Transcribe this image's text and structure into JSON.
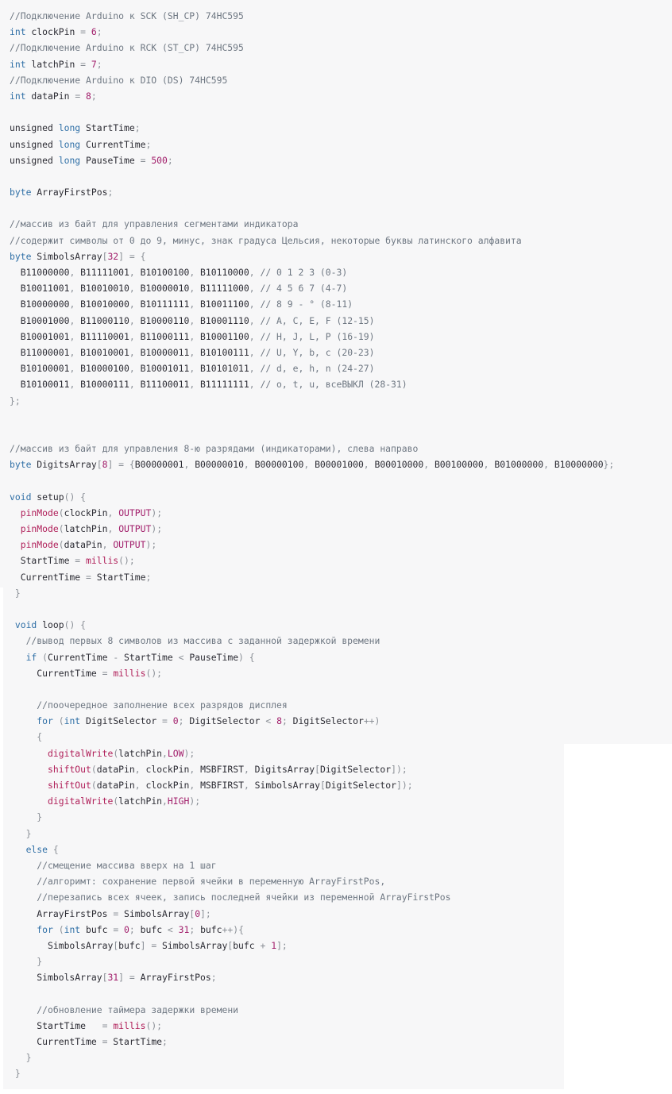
{
  "colors": {
    "background": "#f7f7f8",
    "comment": "#6e7782",
    "keyword": "#2f6fa6",
    "number": "#a11d6a",
    "function": "#b0205a",
    "text": "#2b2b33"
  },
  "code_lines": [
    [
      [
        "c",
        "//Подключение Arduino к SCK (SH_CP) 74HC595"
      ]
    ],
    [
      [
        "k",
        "int"
      ],
      [
        "v",
        " clockPin "
      ],
      [
        "p",
        "="
      ],
      [
        "v",
        " "
      ],
      [
        "n",
        "6"
      ],
      [
        "p",
        ";"
      ]
    ],
    [
      [
        "c",
        "//Подключение Arduino к RCK (ST_CP) 74HC595"
      ]
    ],
    [
      [
        "k",
        "int"
      ],
      [
        "v",
        " latchPin "
      ],
      [
        "p",
        "="
      ],
      [
        "v",
        " "
      ],
      [
        "n",
        "7"
      ],
      [
        "p",
        ";"
      ]
    ],
    [
      [
        "c",
        "//Подключение Arduino к DIO (DS) 74HC595"
      ]
    ],
    [
      [
        "k",
        "int"
      ],
      [
        "v",
        " dataPin "
      ],
      [
        "p",
        "="
      ],
      [
        "v",
        " "
      ],
      [
        "n",
        "8"
      ],
      [
        "p",
        ";"
      ]
    ],
    [],
    [
      [
        "v",
        "unsigned "
      ],
      [
        "k",
        "long"
      ],
      [
        "v",
        " StartTime"
      ],
      [
        "p",
        ";"
      ]
    ],
    [
      [
        "v",
        "unsigned "
      ],
      [
        "k",
        "long"
      ],
      [
        "v",
        " CurrentTime"
      ],
      [
        "p",
        ";"
      ]
    ],
    [
      [
        "v",
        "unsigned "
      ],
      [
        "k",
        "long"
      ],
      [
        "v",
        " PauseTime "
      ],
      [
        "p",
        "="
      ],
      [
        "v",
        " "
      ],
      [
        "n",
        "500"
      ],
      [
        "p",
        ";"
      ]
    ],
    [],
    [
      [
        "k",
        "byte"
      ],
      [
        "v",
        " ArrayFirstPos"
      ],
      [
        "p",
        ";"
      ]
    ],
    [],
    [
      [
        "c",
        "//массив из байт для управления сегментами индикатора"
      ]
    ],
    [
      [
        "c",
        "//содержит символы от 0 до 9, минус, знак градуса Цельсия, некоторые буквы латинского алфавита"
      ]
    ],
    [
      [
        "k",
        "byte"
      ],
      [
        "v",
        " SimbolsArray"
      ],
      [
        "p",
        "["
      ],
      [
        "n",
        "32"
      ],
      [
        "p",
        "]"
      ],
      [
        "v",
        " "
      ],
      [
        "p",
        "="
      ],
      [
        "v",
        " "
      ],
      [
        "p",
        "{"
      ]
    ],
    [
      [
        "v",
        "  B11000000"
      ],
      [
        "p",
        ","
      ],
      [
        "v",
        " B11111001"
      ],
      [
        "p",
        ","
      ],
      [
        "v",
        " B10100100"
      ],
      [
        "p",
        ","
      ],
      [
        "v",
        " B10110000"
      ],
      [
        "p",
        ","
      ],
      [
        "v",
        " "
      ],
      [
        "c",
        "// 0 1 2 3 (0-3)"
      ]
    ],
    [
      [
        "v",
        "  B10011001"
      ],
      [
        "p",
        ","
      ],
      [
        "v",
        " B10010010"
      ],
      [
        "p",
        ","
      ],
      [
        "v",
        " B10000010"
      ],
      [
        "p",
        ","
      ],
      [
        "v",
        " B11111000"
      ],
      [
        "p",
        ","
      ],
      [
        "v",
        " "
      ],
      [
        "c",
        "// 4 5 6 7 (4-7)"
      ]
    ],
    [
      [
        "v",
        "  B10000000"
      ],
      [
        "p",
        ","
      ],
      [
        "v",
        " B10010000"
      ],
      [
        "p",
        ","
      ],
      [
        "v",
        " B10111111"
      ],
      [
        "p",
        ","
      ],
      [
        "v",
        " B10011100"
      ],
      [
        "p",
        ","
      ],
      [
        "v",
        " "
      ],
      [
        "c",
        "// 8 9 - ° (8-11)"
      ]
    ],
    [
      [
        "v",
        "  B10001000"
      ],
      [
        "p",
        ","
      ],
      [
        "v",
        " B11000110"
      ],
      [
        "p",
        ","
      ],
      [
        "v",
        " B10000110"
      ],
      [
        "p",
        ","
      ],
      [
        "v",
        " B10001110"
      ],
      [
        "p",
        ","
      ],
      [
        "v",
        " "
      ],
      [
        "c",
        "// A, C, E, F (12-15)"
      ]
    ],
    [
      [
        "v",
        "  B10001001"
      ],
      [
        "p",
        ","
      ],
      [
        "v",
        " B11110001"
      ],
      [
        "p",
        ","
      ],
      [
        "v",
        " B11000111"
      ],
      [
        "p",
        ","
      ],
      [
        "v",
        " B10001100"
      ],
      [
        "p",
        ","
      ],
      [
        "v",
        " "
      ],
      [
        "c",
        "// H, J, L, P (16-19)"
      ]
    ],
    [
      [
        "v",
        "  B11000001"
      ],
      [
        "p",
        ","
      ],
      [
        "v",
        " B10010001"
      ],
      [
        "p",
        ","
      ],
      [
        "v",
        " B10000011"
      ],
      [
        "p",
        ","
      ],
      [
        "v",
        " B10100111"
      ],
      [
        "p",
        ","
      ],
      [
        "v",
        " "
      ],
      [
        "c",
        "// U, Y, b, c (20-23)"
      ]
    ],
    [
      [
        "v",
        "  B10100001"
      ],
      [
        "p",
        ","
      ],
      [
        "v",
        " B10000100"
      ],
      [
        "p",
        ","
      ],
      [
        "v",
        " B10001011"
      ],
      [
        "p",
        ","
      ],
      [
        "v",
        " B10101011"
      ],
      [
        "p",
        ","
      ],
      [
        "v",
        " "
      ],
      [
        "c",
        "// d, e, h, n (24-27)"
      ]
    ],
    [
      [
        "v",
        "  B10100011"
      ],
      [
        "p",
        ","
      ],
      [
        "v",
        " B10000111"
      ],
      [
        "p",
        ","
      ],
      [
        "v",
        " B11100011"
      ],
      [
        "p",
        ","
      ],
      [
        "v",
        " B11111111"
      ],
      [
        "p",
        ","
      ],
      [
        "v",
        " "
      ],
      [
        "c",
        "// o, t, u, всеВЫКЛ (28-31)"
      ]
    ],
    [
      [
        "p",
        "};"
      ]
    ],
    [],
    [],
    [
      [
        "c",
        "//массив из байт для управления 8-ю разрядами (индикаторами), слева направо"
      ]
    ],
    [
      [
        "k",
        "byte"
      ],
      [
        "v",
        " DigitsArray"
      ],
      [
        "p",
        "["
      ],
      [
        "n",
        "8"
      ],
      [
        "p",
        "]"
      ],
      [
        "v",
        " "
      ],
      [
        "p",
        "="
      ],
      [
        "v",
        " "
      ],
      [
        "p",
        "{"
      ],
      [
        "v",
        "B00000001"
      ],
      [
        "p",
        ","
      ],
      [
        "v",
        " B00000010"
      ],
      [
        "p",
        ","
      ],
      [
        "v",
        " B00000100"
      ],
      [
        "p",
        ","
      ],
      [
        "v",
        " B00001000"
      ],
      [
        "p",
        ","
      ],
      [
        "v",
        " B00010000"
      ],
      [
        "p",
        ","
      ],
      [
        "v",
        " B00100000"
      ],
      [
        "p",
        ","
      ],
      [
        "v",
        " B01000000"
      ],
      [
        "p",
        ","
      ],
      [
        "v",
        " B10000000"
      ],
      [
        "p",
        "};"
      ]
    ],
    [],
    [
      [
        "k",
        "void"
      ],
      [
        "v",
        " setup"
      ],
      [
        "p",
        "()"
      ],
      [
        "v",
        " "
      ],
      [
        "p",
        "{"
      ]
    ],
    [
      [
        "v",
        "  "
      ],
      [
        "f",
        "pinMode"
      ],
      [
        "p",
        "("
      ],
      [
        "v",
        "clockPin"
      ],
      [
        "p",
        ","
      ],
      [
        "v",
        " "
      ],
      [
        "n",
        "OUTPUT"
      ],
      [
        "p",
        ");"
      ]
    ],
    [
      [
        "v",
        "  "
      ],
      [
        "f",
        "pinMode"
      ],
      [
        "p",
        "("
      ],
      [
        "v",
        "latchPin"
      ],
      [
        "p",
        ","
      ],
      [
        "v",
        " "
      ],
      [
        "n",
        "OUTPUT"
      ],
      [
        "p",
        ");"
      ]
    ],
    [
      [
        "v",
        "  "
      ],
      [
        "f",
        "pinMode"
      ],
      [
        "p",
        "("
      ],
      [
        "v",
        "dataPin"
      ],
      [
        "p",
        ","
      ],
      [
        "v",
        " "
      ],
      [
        "n",
        "OUTPUT"
      ],
      [
        "p",
        ");"
      ]
    ],
    [
      [
        "v",
        "  StartTime "
      ],
      [
        "p",
        "="
      ],
      [
        "v",
        " "
      ],
      [
        "f",
        "millis"
      ],
      [
        "p",
        "();"
      ]
    ],
    [
      [
        "v",
        "  CurrentTime "
      ],
      [
        "p",
        "="
      ],
      [
        "v",
        " StartTime"
      ],
      [
        "p",
        ";"
      ]
    ],
    [
      [
        "p",
        " }"
      ]
    ],
    [],
    [
      [
        "v",
        " "
      ],
      [
        "k",
        "void"
      ],
      [
        "v",
        " loop"
      ],
      [
        "p",
        "()"
      ],
      [
        "v",
        " "
      ],
      [
        "p",
        "{"
      ]
    ],
    [
      [
        "v",
        "   "
      ],
      [
        "c",
        "//вывод первых 8 символов из массива с заданной задержкой времени"
      ]
    ],
    [
      [
        "v",
        "   "
      ],
      [
        "k",
        "if"
      ],
      [
        "v",
        " "
      ],
      [
        "p",
        "("
      ],
      [
        "v",
        "CurrentTime "
      ],
      [
        "p",
        "-"
      ],
      [
        "v",
        " StartTime "
      ],
      [
        "p",
        "<"
      ],
      [
        "v",
        " PauseTime"
      ],
      [
        "p",
        ")"
      ],
      [
        "v",
        " "
      ],
      [
        "p",
        "{"
      ]
    ],
    [
      [
        "v",
        "     CurrentTime "
      ],
      [
        "p",
        "="
      ],
      [
        "v",
        " "
      ],
      [
        "f",
        "millis"
      ],
      [
        "p",
        "();"
      ]
    ],
    [],
    [
      [
        "v",
        "     "
      ],
      [
        "c",
        "//поочередное заполнение всех разрядов дисплея"
      ]
    ],
    [
      [
        "v",
        "     "
      ],
      [
        "k",
        "for"
      ],
      [
        "v",
        " "
      ],
      [
        "p",
        "("
      ],
      [
        "k",
        "int"
      ],
      [
        "v",
        " DigitSelector "
      ],
      [
        "p",
        "="
      ],
      [
        "v",
        " "
      ],
      [
        "n",
        "0"
      ],
      [
        "p",
        ";"
      ],
      [
        "v",
        " DigitSelector "
      ],
      [
        "p",
        "<"
      ],
      [
        "v",
        " "
      ],
      [
        "n",
        "8"
      ],
      [
        "p",
        ";"
      ],
      [
        "v",
        " DigitSelector"
      ],
      [
        "p",
        "++)"
      ]
    ],
    [
      [
        "v",
        "     "
      ],
      [
        "p",
        "{"
      ]
    ],
    [
      [
        "v",
        "       "
      ],
      [
        "f",
        "digitalWrite"
      ],
      [
        "p",
        "("
      ],
      [
        "v",
        "latchPin"
      ],
      [
        "p",
        ","
      ],
      [
        "n",
        "LOW"
      ],
      [
        "p",
        ");"
      ]
    ],
    [
      [
        "v",
        "       "
      ],
      [
        "f",
        "shiftOut"
      ],
      [
        "p",
        "("
      ],
      [
        "v",
        "dataPin"
      ],
      [
        "p",
        ","
      ],
      [
        "v",
        " clockPin"
      ],
      [
        "p",
        ","
      ],
      [
        "v",
        " MSBFIRST"
      ],
      [
        "p",
        ","
      ],
      [
        "v",
        " DigitsArray"
      ],
      [
        "p",
        "["
      ],
      [
        "v",
        "DigitSelector"
      ],
      [
        "p",
        "]);"
      ]
    ],
    [
      [
        "v",
        "       "
      ],
      [
        "f",
        "shiftOut"
      ],
      [
        "p",
        "("
      ],
      [
        "v",
        "dataPin"
      ],
      [
        "p",
        ","
      ],
      [
        "v",
        " clockPin"
      ],
      [
        "p",
        ","
      ],
      [
        "v",
        " MSBFIRST"
      ],
      [
        "p",
        ","
      ],
      [
        "v",
        " SimbolsArray"
      ],
      [
        "p",
        "["
      ],
      [
        "v",
        "DigitSelector"
      ],
      [
        "p",
        "]);"
      ]
    ],
    [
      [
        "v",
        "       "
      ],
      [
        "f",
        "digitalWrite"
      ],
      [
        "p",
        "("
      ],
      [
        "v",
        "latchPin"
      ],
      [
        "p",
        ","
      ],
      [
        "n",
        "HIGH"
      ],
      [
        "p",
        ");"
      ]
    ],
    [
      [
        "v",
        "     "
      ],
      [
        "p",
        "}"
      ]
    ],
    [
      [
        "v",
        "   "
      ],
      [
        "p",
        "}"
      ]
    ],
    [
      [
        "v",
        "   "
      ],
      [
        "k",
        "else"
      ],
      [
        "v",
        " "
      ],
      [
        "p",
        "{"
      ]
    ],
    [
      [
        "v",
        "     "
      ],
      [
        "c",
        "//смещение массива вверх на 1 шаг"
      ]
    ],
    [
      [
        "v",
        "     "
      ],
      [
        "c",
        "//алгоримт: сохранение первой ячейки в переменную ArrayFirstPos,"
      ]
    ],
    [
      [
        "v",
        "     "
      ],
      [
        "c",
        "//перезапись всех ячеек, запись последней ячейки из переменной ArrayFirstPos"
      ]
    ],
    [
      [
        "v",
        "     ArrayFirstPos "
      ],
      [
        "p",
        "="
      ],
      [
        "v",
        " SimbolsArray"
      ],
      [
        "p",
        "["
      ],
      [
        "n",
        "0"
      ],
      [
        "p",
        "];"
      ]
    ],
    [
      [
        "v",
        "     "
      ],
      [
        "k",
        "for"
      ],
      [
        "v",
        " "
      ],
      [
        "p",
        "("
      ],
      [
        "k",
        "int"
      ],
      [
        "v",
        " bufc "
      ],
      [
        "p",
        "="
      ],
      [
        "v",
        " "
      ],
      [
        "n",
        "0"
      ],
      [
        "p",
        ";"
      ],
      [
        "v",
        " bufc "
      ],
      [
        "p",
        "<"
      ],
      [
        "v",
        " "
      ],
      [
        "n",
        "31"
      ],
      [
        "p",
        ";"
      ],
      [
        "v",
        " bufc"
      ],
      [
        "p",
        "++){"
      ]
    ],
    [
      [
        "v",
        "       SimbolsArray"
      ],
      [
        "p",
        "["
      ],
      [
        "v",
        "bufc"
      ],
      [
        "p",
        "]"
      ],
      [
        "v",
        " "
      ],
      [
        "p",
        "="
      ],
      [
        "v",
        " SimbolsArray"
      ],
      [
        "p",
        "["
      ],
      [
        "v",
        "bufc "
      ],
      [
        "p",
        "+"
      ],
      [
        "v",
        " "
      ],
      [
        "n",
        "1"
      ],
      [
        "p",
        "];"
      ]
    ],
    [
      [
        "v",
        "     "
      ],
      [
        "p",
        "}"
      ]
    ],
    [
      [
        "v",
        "     SimbolsArray"
      ],
      [
        "p",
        "["
      ],
      [
        "n",
        "31"
      ],
      [
        "p",
        "]"
      ],
      [
        "v",
        " "
      ],
      [
        "p",
        "="
      ],
      [
        "v",
        " ArrayFirstPos"
      ],
      [
        "p",
        ";"
      ]
    ],
    [],
    [
      [
        "v",
        "     "
      ],
      [
        "c",
        "//обновление таймера задержки времени"
      ]
    ],
    [
      [
        "v",
        "     StartTime   "
      ],
      [
        "p",
        "="
      ],
      [
        "v",
        " "
      ],
      [
        "f",
        "millis"
      ],
      [
        "p",
        "();"
      ]
    ],
    [
      [
        "v",
        "     CurrentTime "
      ],
      [
        "p",
        "="
      ],
      [
        "v",
        " StartTime"
      ],
      [
        "p",
        ";"
      ]
    ],
    [
      [
        "v",
        "   "
      ],
      [
        "p",
        "}"
      ]
    ],
    [
      [
        "p",
        " }"
      ]
    ]
  ]
}
